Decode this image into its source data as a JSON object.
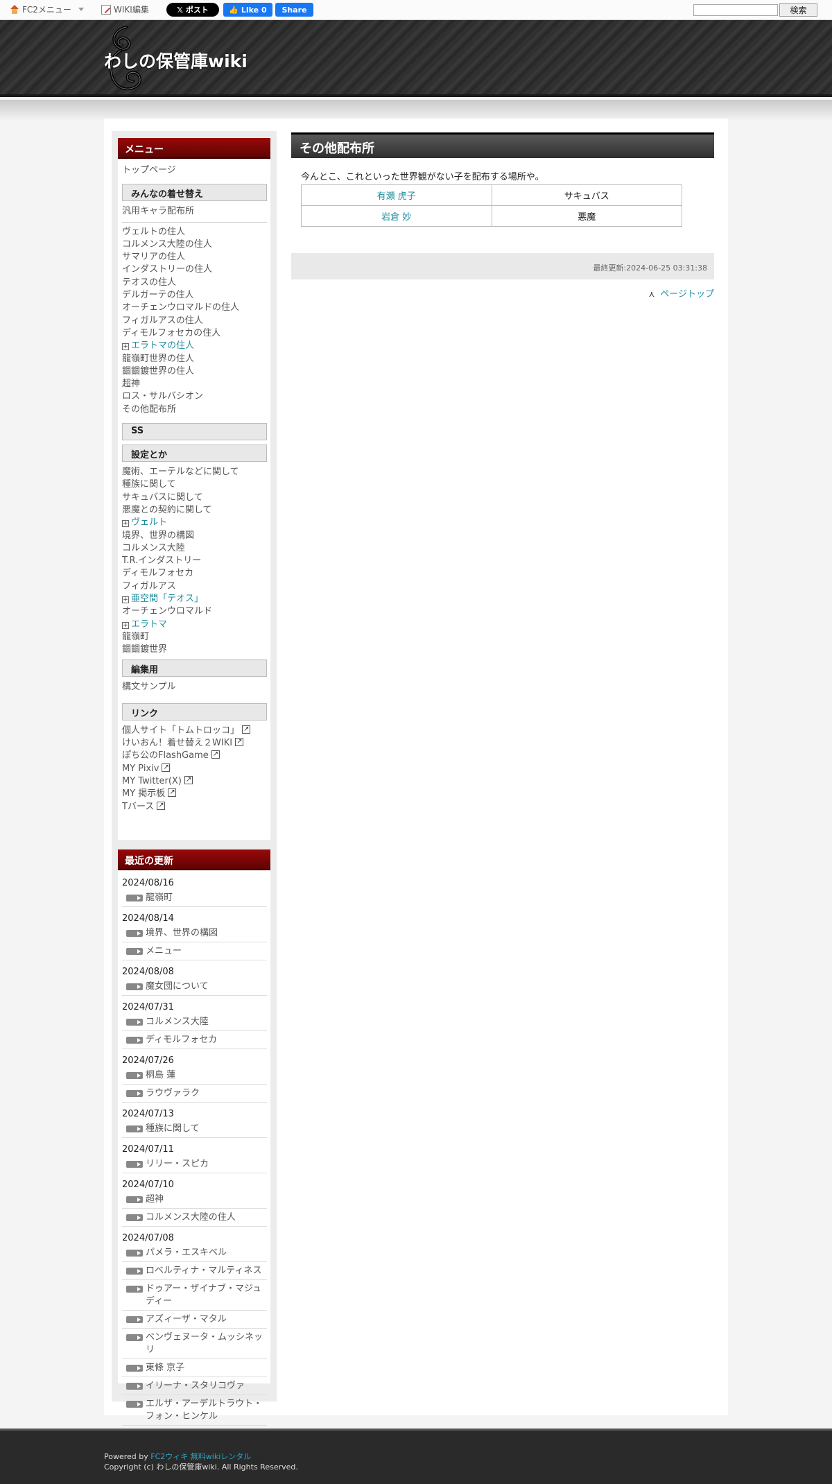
{
  "toolbar": {
    "fc2_menu": "FC2メニュー",
    "wiki_edit": "WIKI編集",
    "x_post": "𝕏 ポスト",
    "fb_like": "👍 Like 0",
    "fb_share": "Share",
    "search_button": "検索"
  },
  "header": {
    "site_title": "わしの保管庫wiki"
  },
  "menu": {
    "title": "メニュー",
    "top_page": "トップページ",
    "sec1": "みんなの着せ替え",
    "general": "汎用キャラ配布所",
    "items1": [
      {
        "label": "ヴェルトの住人",
        "expand": false
      },
      {
        "label": "コルメンス大陸の住人",
        "expand": false
      },
      {
        "label": "サマリアの住人",
        "expand": false
      },
      {
        "label": "インダストリーの住人",
        "expand": false
      },
      {
        "label": "テオスの住人",
        "expand": false
      },
      {
        "label": "デルガーテの住人",
        "expand": false
      },
      {
        "label": "オーチェンウロマルドの住人",
        "expand": false
      },
      {
        "label": "フィガルアスの住人",
        "expand": false
      },
      {
        "label": "ディモルフォセカの住人",
        "expand": false
      },
      {
        "label": "エラトマの住人",
        "expand": true
      },
      {
        "label": "龍嶺町世界の住人",
        "expand": false
      },
      {
        "label": "錮錮鍍世界の住人",
        "expand": false
      },
      {
        "label": "超神",
        "expand": false
      },
      {
        "label": "ロス・サルバシオン",
        "expand": false
      },
      {
        "label": "その他配布所",
        "expand": false
      }
    ],
    "sec_ss": "SS",
    "sec_settings": "設定とか",
    "items2": [
      {
        "label": "魔術、エーテルなどに関して",
        "expand": false
      },
      {
        "label": "種族に関して",
        "expand": false
      },
      {
        "label": "サキュバスに関して",
        "expand": false
      },
      {
        "label": "悪魔との契約に関して",
        "expand": false
      },
      {
        "label": "ヴェルト",
        "expand": true
      },
      {
        "label": "境界、世界の構図",
        "expand": false
      },
      {
        "label": "コルメンス大陸",
        "expand": false
      },
      {
        "label": "T.R.インダストリー",
        "expand": false
      },
      {
        "label": "ディモルフォセカ",
        "expand": false
      },
      {
        "label": "フィガルアス",
        "expand": false
      },
      {
        "label": "亜空間「テオス」",
        "expand": true
      },
      {
        "label": "オーチェンウロマルド",
        "expand": false
      },
      {
        "label": "エラトマ",
        "expand": true
      },
      {
        "label": "龍嶺町",
        "expand": false
      },
      {
        "label": "錮錮鍍世界",
        "expand": false
      }
    ],
    "sec_edit": "編集用",
    "syntax_sample": "構文サンプル",
    "sec_links": "リンク",
    "links": [
      "個人サイト「トムトロッコ」",
      "けいおん！着せ替え２WIKI",
      "ぽち公のFlashGame",
      "MY Pixiv",
      "MY Twitter(X)",
      "MY 掲示板",
      "Tバース"
    ]
  },
  "recent": {
    "title": "最近の更新",
    "groups": [
      {
        "date": "2024/08/16",
        "items": [
          "龍嶺町"
        ]
      },
      {
        "date": "2024/08/14",
        "items": [
          "境界、世界の構図",
          "メニュー"
        ]
      },
      {
        "date": "2024/08/08",
        "items": [
          "魔女団について"
        ]
      },
      {
        "date": "2024/07/31",
        "items": [
          "コルメンス大陸",
          "ディモルフォセカ"
        ]
      },
      {
        "date": "2024/07/26",
        "items": [
          "桐島 蓮",
          "ラウヴァラク"
        ]
      },
      {
        "date": "2024/07/13",
        "items": [
          "種族に関して"
        ]
      },
      {
        "date": "2024/07/11",
        "items": [
          "リリー・スピカ"
        ]
      },
      {
        "date": "2024/07/10",
        "items": [
          "超神",
          "コルメンス大陸の住人"
        ]
      },
      {
        "date": "2024/07/08",
        "items": [
          "パメラ・エスキベル",
          "ロベルティナ・マルティネス",
          "ドゥアー・ザイナブ・マジュディー",
          "アズィーザ・マタル",
          "ベンヴェヌータ・ムッシネッリ",
          "東條 京子",
          "イリーナ・スタリコヴァ",
          "エルザ・アーデルトラウト・フォン・ヒンケル"
        ]
      }
    ]
  },
  "main": {
    "page_title": "その他配布所",
    "intro": "今んとこ、これといった世界観がない子を配布する場所や。",
    "table": [
      {
        "name": "有瀬 虎子",
        "type": "サキュバス"
      },
      {
        "name": "岩倉 妙",
        "type": "悪魔"
      }
    ],
    "last_updated": "最終更新:2024-06-25 03:31:38",
    "page_top": "ページトップ"
  },
  "footer": {
    "powered_by": "Powered by",
    "fc2_link": "FC2ウィキ 無料wikiレンタル",
    "copyright": "Copyright (c) わしの保管庫wiki. All Rights Reserved."
  }
}
